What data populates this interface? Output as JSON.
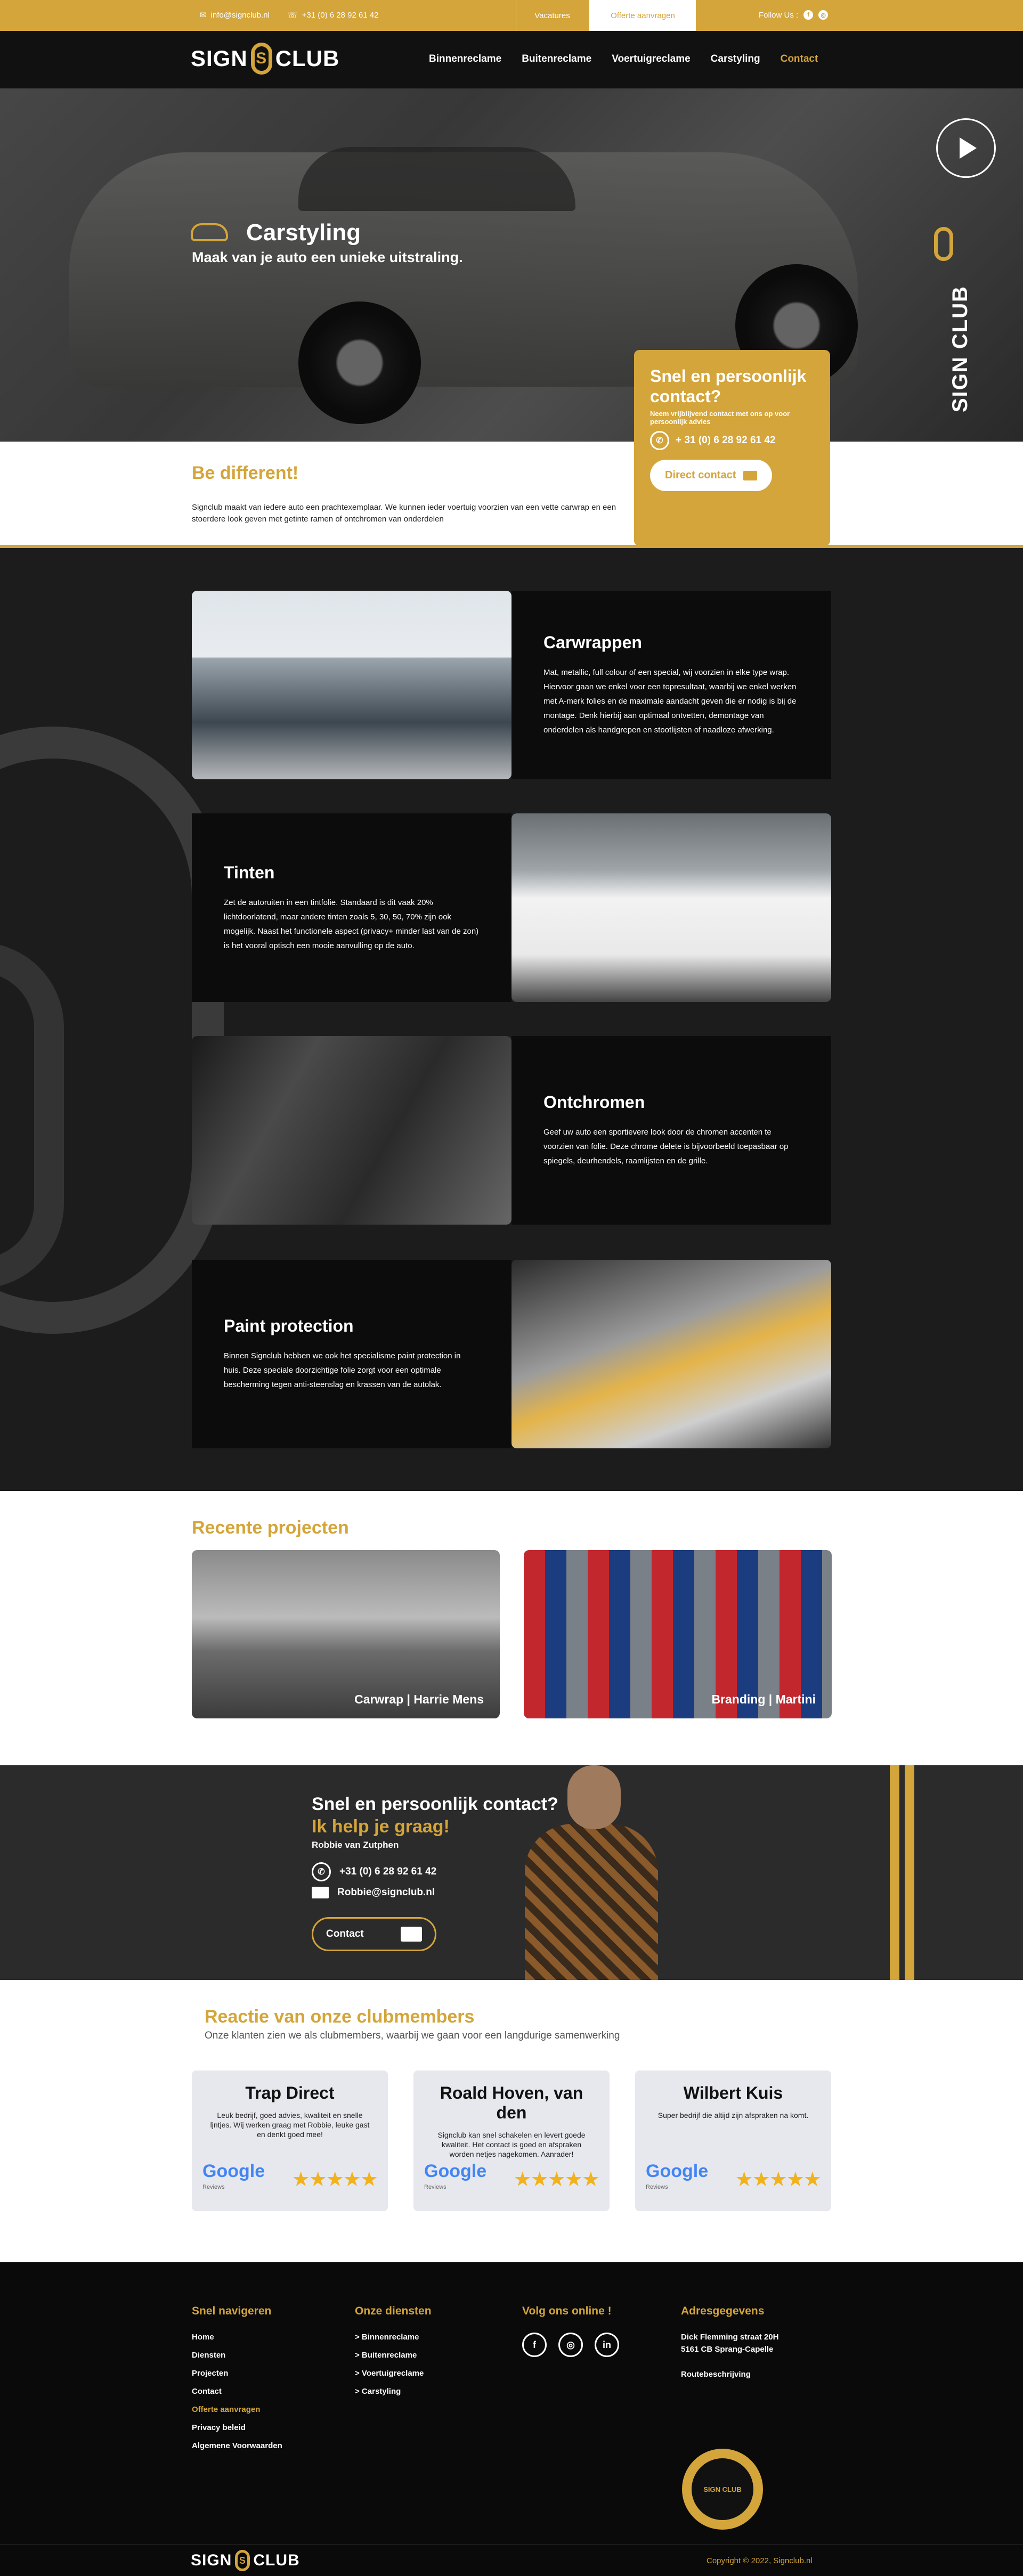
{
  "topbar": {
    "email": "info@signclub.nl",
    "phone": "+31 (0) 6 28 92 61 42",
    "vacatures": "Vacatures",
    "offerte": "Offerte aanvragen",
    "follow": "Follow Us :",
    "socials": [
      "facebook-icon",
      "instagram-icon"
    ]
  },
  "header": {
    "logo_left": "SIGN",
    "logo_right": "CLUB",
    "nav": [
      "Binnenreclame",
      "Buitenreclame",
      "Voertuigreclame",
      "Carstyling",
      "Contact"
    ]
  },
  "hero": {
    "title": "Carstyling",
    "subtitle": "Maak van je auto een unieke uitstraling.",
    "side_text": "SIGN CLUB"
  },
  "contact_card": {
    "title": "Snel en persoonlijk contact?",
    "note": "Neem vrijblijvend contact met ons op voor persoonlijk advies",
    "phone": "+ 31 (0) 6 28 92 61 42",
    "button": "Direct contact"
  },
  "intro": {
    "title": "Be different!",
    "text": "Signclub maakt van iedere auto een prachtexemplaar. We kunnen ieder voertuig voorzien van een vette carwrap en een stoerdere look geven met getinte ramen of ontchromen van onderdelen"
  },
  "services": [
    {
      "title": "Carwrappen",
      "text": "Mat, metallic, full colour of een special, wij voorzien in elke type wrap. Hiervoor gaan we enkel voor een topresultaat, waarbij we enkel werken met A-merk folies en de maximale aandacht geven die er nodig is bij de montage. Denk hierbij aan optimaal ontvetten, demontage van onderdelen als handgrepen en stootlijsten of naadloze afwerking."
    },
    {
      "title": "Tinten",
      "text": "Zet de autoruiten in een tintfolie. Standaard is dit vaak 20% lichtdoorlatend, maar andere tinten zoals 5, 30, 50, 70% zijn ook mogelijk. Naast het functionele aspect (privacy+ minder last van de zon) is het vooral optisch een mooie aanvulling op de auto."
    },
    {
      "title": "Ontchromen",
      "text": "Geef uw auto een sportievere look door de chromen accenten te voorzien van folie. Deze chrome delete is bijvoorbeeld toepasbaar op spiegels, deurhendels, raamlijsten en de grille."
    },
    {
      "title": "Paint protection",
      "text": "Binnen Signclub hebben we ook het specialisme paint protection in huis. Deze speciale doorzichtige folie zorgt voor een optimale bescherming tegen anti-steenslag en krassen van de autolak."
    }
  ],
  "projects": {
    "title": "Recente projecten",
    "items": [
      {
        "caption": "Carwrap | Harrie Mens"
      },
      {
        "caption": "Branding | Martini"
      }
    ]
  },
  "band": {
    "title": "Snel en persoonlijk contact?",
    "subtitle": "Ik help je graag!",
    "name": "Robbie van Zutphen",
    "phone": "+31 (0) 6 28 92 61 42",
    "email": "Robbie@signclub.nl",
    "button": "Contact"
  },
  "reviews": {
    "title": "Reactie van onze clubmembers",
    "subtitle": "Onze klanten zien we als clubmembers, waarbij we gaan voor een langdurige samenwerking",
    "google": "Google",
    "google_sub": "Reviews",
    "stars": "★★★★★",
    "items": [
      {
        "name": "Trap Direct",
        "text": "Leuk bedrijf, goed advies, kwaliteit en snelle ljntjes. Wij werken graag met Robbie, leuke gast en denkt goed mee!"
      },
      {
        "name": "Roald Hoven, van den",
        "text": "Signclub kan snel schakelen en levert goede kwaliteit. Het contact is goed en afspraken worden netjes nagekomen. Aanrader!"
      },
      {
        "name": "Wilbert Kuis",
        "text": "Super bedrijf die altijd zijn afspraken na komt."
      }
    ]
  },
  "footer": {
    "nav_title": "Snel navigeren",
    "nav": [
      "Home",
      "Diensten",
      "Projecten",
      "Contact",
      "Offerte aanvragen",
      "Privacy beleid",
      "Algemene Voorwaarden"
    ],
    "services_title": "Onze diensten",
    "services": [
      "> Binnenreclame",
      "> Buitenreclame",
      "> Voertuigreclame",
      "> Carstyling"
    ],
    "follow_title": "Volg ons online !",
    "social": [
      "f",
      "◎",
      "in"
    ],
    "address_title": "Adresgegevens",
    "address1": "Dick Flemming straat 20H",
    "address2": "5161 CB Sprang-Capelle",
    "route": "Routebeschrijving",
    "seal": "SIGN CLUB"
  },
  "copyright": "Copyright © 2022, Signclub.nl",
  "colors": {
    "accent": "#d4a53a",
    "dark": "#1c1c1c"
  }
}
